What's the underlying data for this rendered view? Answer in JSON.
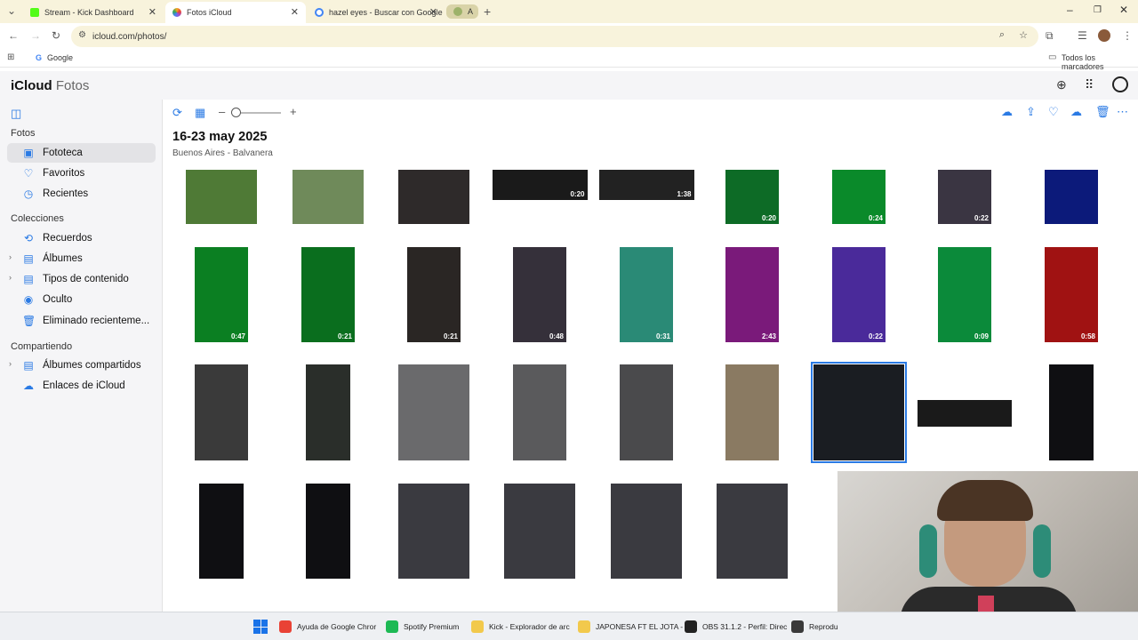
{
  "browser": {
    "tabs": [
      {
        "title": "Stream - Kick Dashboard",
        "color": "#53fc18"
      },
      {
        "title": "Fotos iCloud",
        "color": "#f5a623"
      },
      {
        "title": "hazel eyes - Buscar con Google",
        "color": "#4285f4"
      },
      {
        "title": "A",
        "color": "#9db26a"
      }
    ],
    "url": "icloud.com/photos/",
    "bookmark": "Google",
    "all_bookmarks": "Todos los marcadores"
  },
  "icloud": {
    "brand": "iCloud",
    "app": "Fotos"
  },
  "sidebar": {
    "sections": [
      "Fotos",
      "Colecciones",
      "Compartiendo"
    ],
    "fotos_items": [
      {
        "label": "Fototeca",
        "icon": "library-icon"
      },
      {
        "label": "Favoritos",
        "icon": "heart-icon"
      },
      {
        "label": "Recientes",
        "icon": "clock-icon"
      }
    ],
    "colecciones_items": [
      {
        "label": "Recuerdos",
        "icon": "memories-icon"
      },
      {
        "label": "Álbumes",
        "icon": "album-icon"
      },
      {
        "label": "Tipos de contenido",
        "icon": "album-icon"
      },
      {
        "label": "Oculto",
        "icon": "eye-slash-icon"
      },
      {
        "label": "Eliminado recienteme...",
        "icon": "trash-icon"
      }
    ],
    "compartiendo_items": [
      {
        "label": "Álbumes compartidos",
        "icon": "shared-album-icon"
      },
      {
        "label": "Enlaces de iCloud",
        "icon": "cloud-link-icon"
      }
    ]
  },
  "main": {
    "date_range": "16-23 may 2025",
    "location": "Buenos Aires - Balvanera",
    "rows": [
      [
        {
          "dur": "",
          "c": "#4f7a36"
        },
        {
          "dur": "",
          "c": "#6f8a5a"
        },
        {
          "dur": "",
          "c": "#2e2a2a"
        },
        {
          "dur": "0:20",
          "c": "#1a1a1a"
        },
        {
          "dur": "1:38",
          "c": "#222"
        },
        {
          "dur": "0:20",
          "c": "#0d6b26"
        },
        {
          "dur": "0:24",
          "c": "#0a8a2a"
        },
        {
          "dur": "0:22",
          "c": "#3a3542"
        },
        {
          "dur": "",
          "c": "#0c1a7a"
        }
      ],
      [
        {
          "dur": "0:47",
          "c": "#0b7f22"
        },
        {
          "dur": "0:21",
          "c": "#0a6e1e"
        },
        {
          "dur": "0:21",
          "c": "#2a2624"
        },
        {
          "dur": "0:48",
          "c": "#35303a"
        },
        {
          "dur": "0:31",
          "c": "#2a8a76"
        },
        {
          "dur": "2:43",
          "c": "#7a1a7a"
        },
        {
          "dur": "0:22",
          "c": "#4a2a9a"
        },
        {
          "dur": "0:09",
          "c": "#0b8a3a"
        },
        {
          "dur": "0:58",
          "c": "#a01212"
        }
      ],
      [
        {
          "dur": "",
          "c": "#3a3a3a"
        },
        {
          "dur": "",
          "c": "#2a2e2a"
        },
        {
          "dur": "",
          "c": "#6a6a6c"
        },
        {
          "dur": "",
          "c": "#5a5a5c"
        },
        {
          "dur": "",
          "c": "#4a4a4c"
        },
        {
          "dur": "",
          "c": "#8a7a62"
        },
        {
          "dur": "",
          "c": "#1a1d22"
        },
        {
          "dur": "",
          "c": "#1a1a1a"
        },
        {
          "dur": "",
          "c": "#0f0f12"
        }
      ],
      [
        {
          "dur": "",
          "c": "#0f0f12"
        },
        {
          "dur": "",
          "c": "#0f0f12"
        },
        {
          "dur": "",
          "c": "#3a3a40"
        },
        {
          "dur": "",
          "c": "#3a3a40"
        },
        {
          "dur": "",
          "c": "#3a3a40"
        },
        {
          "dur": "",
          "c": "#3a3a40"
        }
      ]
    ]
  },
  "taskbar": [
    {
      "label": "Ayuda de Google Chror",
      "color": "#e94235"
    },
    {
      "label": "Spotify Premium",
      "color": "#1db954"
    },
    {
      "label": "Kick - Explorador de arc",
      "color": "#f2c94c"
    },
    {
      "label": "JAPONESA FT EL JOTA -",
      "color": "#f2c94c"
    },
    {
      "label": "OBS 31.1.2 - Perfil: Direc",
      "color": "#222"
    },
    {
      "label": "Reprodu",
      "color": "#3a3a3a"
    }
  ]
}
